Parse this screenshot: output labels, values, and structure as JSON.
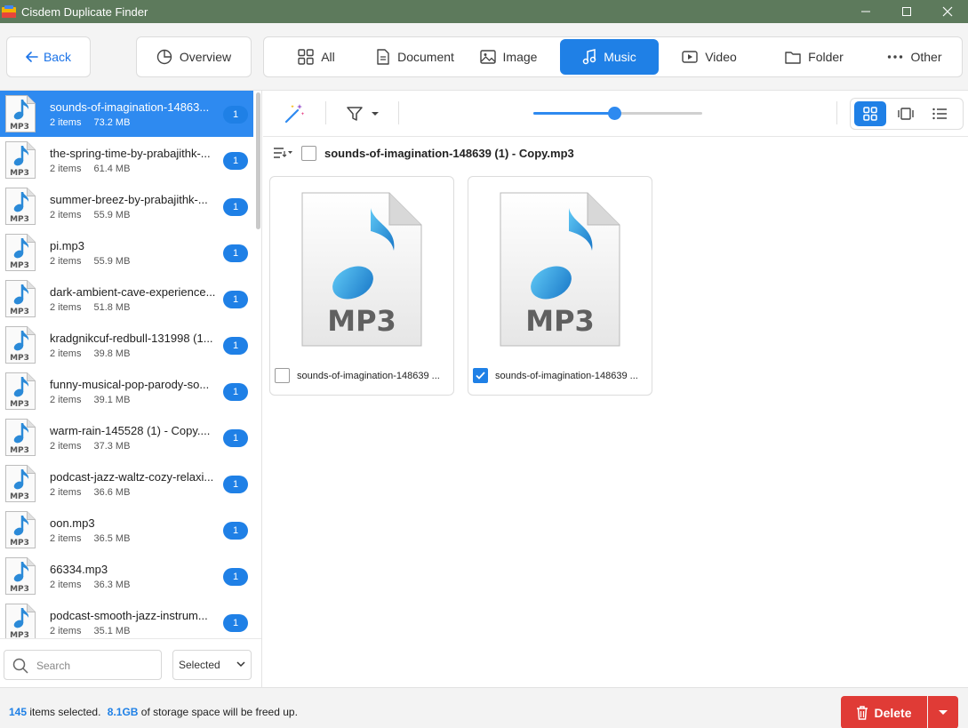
{
  "window": {
    "title": "Cisdem Duplicate Finder",
    "controls": [
      "minimize-icon",
      "maximize-icon",
      "close-icon"
    ]
  },
  "nav": {
    "back_label": "Back",
    "overview_label": "Overview",
    "tabs": [
      {
        "label": "All",
        "icon": "grid-icon",
        "active": false
      },
      {
        "label": "Document",
        "icon": "document-icon",
        "active": false
      },
      {
        "label": "Image",
        "icon": "image-icon",
        "active": false
      },
      {
        "label": "Music",
        "icon": "music-note-icon",
        "active": true
      },
      {
        "label": "Video",
        "icon": "video-icon",
        "active": false
      },
      {
        "label": "Folder",
        "icon": "folder-icon",
        "active": false
      },
      {
        "label": "Other",
        "icon": "more-icon",
        "active": false
      }
    ]
  },
  "sidebar": {
    "items": [
      {
        "name": "sounds-of-imagination-14863...",
        "count": "2 items",
        "size": "73.2 MB",
        "badge": "1",
        "selected": true
      },
      {
        "name": "the-spring-time-by-prabajithk-...",
        "count": "2 items",
        "size": "61.4 MB",
        "badge": "1"
      },
      {
        "name": "summer-breez-by-prabajithk-...",
        "count": "2 items",
        "size": "55.9 MB",
        "badge": "1"
      },
      {
        "name": "pi.mp3",
        "count": "2 items",
        "size": "55.9 MB",
        "badge": "1"
      },
      {
        "name": "dark-ambient-cave-experience...",
        "count": "2 items",
        "size": "51.8 MB",
        "badge": "1"
      },
      {
        "name": "kradgnikcuf-redbull-131998 (1...",
        "count": "2 items",
        "size": "39.8 MB",
        "badge": "1"
      },
      {
        "name": "funny-musical-pop-parody-so...",
        "count": "2 items",
        "size": "39.1 MB",
        "badge": "1"
      },
      {
        "name": "warm-rain-145528 (1) - Copy....",
        "count": "2 items",
        "size": "37.3 MB",
        "badge": "1"
      },
      {
        "name": "podcast-jazz-waltz-cozy-relaxi...",
        "count": "2 items",
        "size": "36.6 MB",
        "badge": "1"
      },
      {
        "name": "oon.mp3",
        "count": "2 items",
        "size": "36.5 MB",
        "badge": "1"
      },
      {
        "name": "66334.mp3",
        "count": "2 items",
        "size": "36.3 MB",
        "badge": "1"
      },
      {
        "name": "podcast-smooth-jazz-instrum...",
        "count": "2 items",
        "size": "35.1 MB",
        "badge": "1"
      }
    ],
    "thumb_label": "MP3",
    "search_placeholder": "Search",
    "filter_value": "Selected"
  },
  "group": {
    "title": "sounds-of-imagination-148639 (1) - Copy.mp3",
    "files": [
      {
        "label": "sounds-of-imagination-148639 ...",
        "checked": false,
        "icon_text": "MP3"
      },
      {
        "label": "sounds-of-imagination-148639 ...",
        "checked": true,
        "icon_text": "MP3"
      }
    ]
  },
  "toolbar": {
    "zoom_level": 0.48
  },
  "footer": {
    "selected_count": "145",
    "selected_text": "items selected.",
    "storage_size": "8.1GB",
    "storage_text": "of storage space will be freed up.",
    "delete_label": "Delete"
  },
  "colors": {
    "accent": "#1f80e6",
    "titlebar": "#5d7a5c",
    "danger": "#e03b36"
  }
}
